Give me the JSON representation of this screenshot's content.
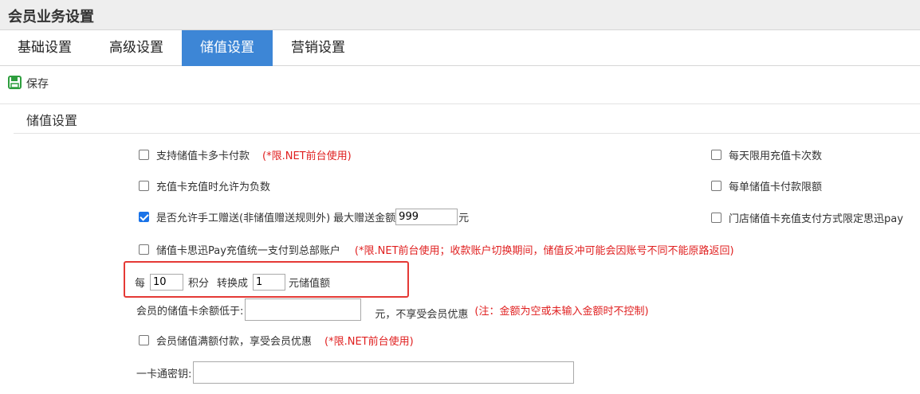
{
  "header": {
    "title": "会员业务设置"
  },
  "tabs": [
    {
      "label": "基础设置"
    },
    {
      "label": "高级设置"
    },
    {
      "label": "储值设置"
    },
    {
      "label": "营销设置"
    }
  ],
  "active_tab": "储值设置",
  "toolbar": {
    "save_label": "保存",
    "save_icon": "save-icon"
  },
  "section": {
    "title": "储值设置"
  },
  "options": {
    "multi_card": {
      "label": "支持储值卡多卡付款",
      "note": "(*限.NET前台使用)",
      "checked": false
    },
    "allow_negative": {
      "label": "充值卡充值时允许为负数",
      "checked": false
    },
    "manual_gift": {
      "label": "是否允许手工赠送(非储值赠送规则外)",
      "max_label": "最大赠送金额",
      "max_value": "999",
      "unit": "元",
      "checked": true
    },
    "pay_unified": {
      "label": "储值卡思迅Pay充值统一支付到总部账户",
      "note": "(*限.NET前台使用；收款账户切换期间，储值反冲可能会因账号不同不能原路返回)",
      "checked": false
    },
    "daily_limit": {
      "label": "每天限用充值卡次数",
      "checked": false
    },
    "single_limit": {
      "label": "每单储值卡付款限额",
      "checked": false
    },
    "store_pay_limit": {
      "label": "门店储值卡充值支付方式限定思迅pay",
      "checked": false
    },
    "full_pay_discount": {
      "label": "会员储值满额付款，享受会员优惠",
      "note": "(*限.NET前台使用)",
      "checked": false
    }
  },
  "points_convert": {
    "prefix": "每",
    "points_value": "10",
    "points_label": "积分",
    "convert_label": "转换成",
    "amount_value": "1",
    "amount_label": "元储值额"
  },
  "balance_threshold": {
    "label": "会员的储值卡余额低于:",
    "value": "",
    "suffix": "元，不享受会员优惠",
    "note": "(注：金额为空或未输入金额时不控制)"
  },
  "card_key": {
    "label": "一卡通密钥:",
    "value": ""
  },
  "colors": {
    "tab_active": "#3d86d6",
    "note_red": "#e02020",
    "highlight_border": "#e53935",
    "save_icon_green": "#2e9e3e"
  }
}
